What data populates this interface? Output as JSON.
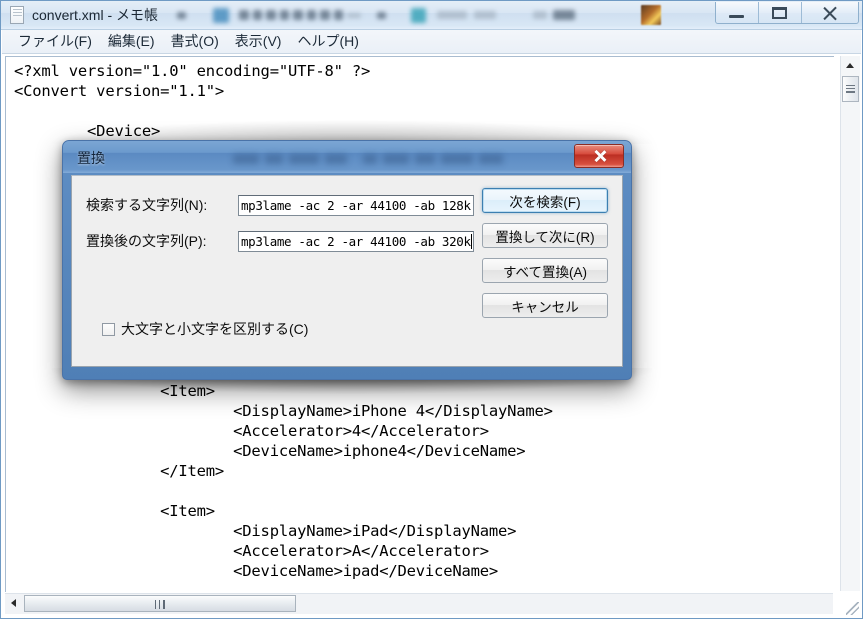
{
  "window": {
    "title": "convert.xml - メモ帳",
    "icon": "notepad-document-icon",
    "controls": {
      "minimize": "minimize-icon",
      "maximize": "maximize-icon",
      "close": "close-icon"
    }
  },
  "menubar": {
    "items": [
      {
        "label": "ファイル(F)"
      },
      {
        "label": "編集(E)"
      },
      {
        "label": "書式(O)"
      },
      {
        "label": "表示(V)"
      },
      {
        "label": "ヘルプ(H)"
      }
    ]
  },
  "editor": {
    "content": "<?xml version=\"1.0\" encoding=\"UTF-8\" ?>\n<Convert version=\"1.1\">\n\n        <Device>\n                <Item>\n                        <DisplayName>iPhone 3G</DisplayName>\n                        <Accelerator>3</Accelerator>\n                        <DeviceName>iphone3g</DeviceName>\n                </Item>\n\n                <Item>\n                        <DisplayName>iPhone 3GS</DisplayName>\n                        <Accelerator>3</Accelerator>\n                        <DeviceName>iphone3gs</DeviceName>\n                </Item>\n\n                <Item>\n                        <DisplayName>iPhone 4</DisplayName>\n                        <Accelerator>4</Accelerator>\n                        <DeviceName>iphone4</DeviceName>\n                </Item>\n\n                <Item>\n                        <DisplayName>iPad</DisplayName>\n                        <Accelerator>A</Accelerator>\n                        <DeviceName>ipad</DeviceName>"
  },
  "scrollbars": {
    "vertical": {
      "up_arrow": "scroll-up-arrow-icon"
    },
    "horizontal": {
      "left_arrow": "scroll-left-arrow-icon"
    }
  },
  "dialog": {
    "title": "置換",
    "close_label": "close-icon",
    "fields": [
      {
        "label": "検索する文字列(N):",
        "value": "mp3lame -ac 2 -ar 44100 -ab 128k",
        "focused": false
      },
      {
        "label": "置換後の文字列(P):",
        "value": "mp3lame -ac 2 -ar 44100 -ab 320k",
        "focused": true
      }
    ],
    "buttons": [
      {
        "label": "次を検索(F)",
        "focused": true
      },
      {
        "label": "置換して次に(R)",
        "focused": false
      },
      {
        "label": "すべて置換(A)",
        "focused": false
      },
      {
        "label": "キャンセル",
        "focused": false
      }
    ],
    "checkbox": {
      "label": "大文字と小文字を区別する(C)",
      "checked": false
    }
  },
  "colors": {
    "aero_frame": "#4f7fb6",
    "close_red": "#bb2d22",
    "focus_blue": "#3c7fb1",
    "dialog_body": "#efefef",
    "text": "#000000"
  }
}
